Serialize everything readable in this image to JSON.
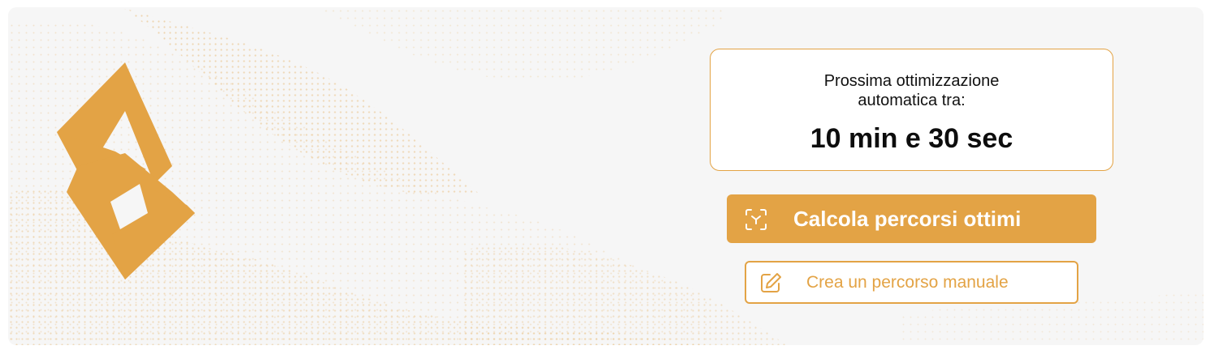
{
  "theme": {
    "accent": "#e3a345",
    "background": "#f6f6f6"
  },
  "timer": {
    "label": "Prossima ottimizzazione automatica tra:",
    "value": "10 min e 30 sec"
  },
  "actions": {
    "primary": {
      "label": "Calcola percorsi ottimi",
      "icon": "scan-target-icon"
    },
    "secondary": {
      "label": "Crea un percorso manuale",
      "icon": "edit-pencil-icon"
    }
  },
  "branding": {
    "logo": "brand-logo-icon"
  }
}
